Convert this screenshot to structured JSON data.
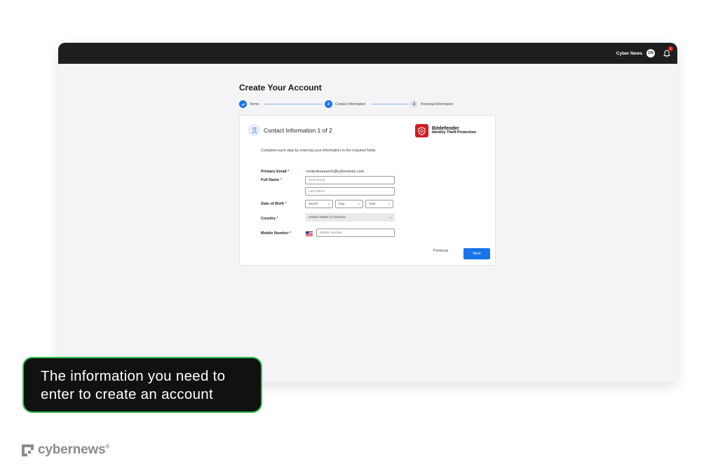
{
  "topbar": {
    "user_name": "Cyber News",
    "avatar_initials": "CN",
    "notification_count": "1"
  },
  "page_title": "Create Your Account",
  "stepper": {
    "steps": [
      {
        "number": "",
        "label": "Terms",
        "state": "done"
      },
      {
        "number": "2",
        "label": "Contact Information",
        "state": "active"
      },
      {
        "number": "3",
        "label": "Personal Information",
        "state": "todo"
      }
    ]
  },
  "card": {
    "title": "Contact Information 1 of 2",
    "brand_name": "Bitdefender",
    "brand_sub": "Identity Theft Protection",
    "intro": "Complete each step by entering your information in the required fields.",
    "fields": {
      "email_label": "Primary Email",
      "email_value": "contentresearch@cybernews.com",
      "fullname_label": "Full Name",
      "first_name_placeholder": "First Name",
      "last_name_placeholder": "Last Name",
      "dob_label": "Date of Birth",
      "month": "Month",
      "day": "Day",
      "year": "Year",
      "country_label": "Country",
      "country_value": "United States of America",
      "mobile_label": "Mobile Number",
      "mobile_placeholder": "Mobile Number",
      "required_mark": "*"
    },
    "buttons": {
      "previous": "Previous",
      "next": "Next"
    }
  },
  "caption": {
    "line1": "The information you need to",
    "line2": "enter to create an account"
  },
  "footer": {
    "logo_text": "cybernews",
    "logo_reg": "®"
  },
  "colors": {
    "accent": "#1a73e8",
    "brand_red": "#d01d24",
    "caption_border": "#37c34f",
    "topbar": "#1e1e1e"
  },
  "icons": {
    "check": "check-icon",
    "person": "person-icon",
    "bell": "bell-icon",
    "shield": "bitdefender-shield-icon",
    "flag": "us-flag-icon",
    "chevron": "chevron-down-icon"
  }
}
